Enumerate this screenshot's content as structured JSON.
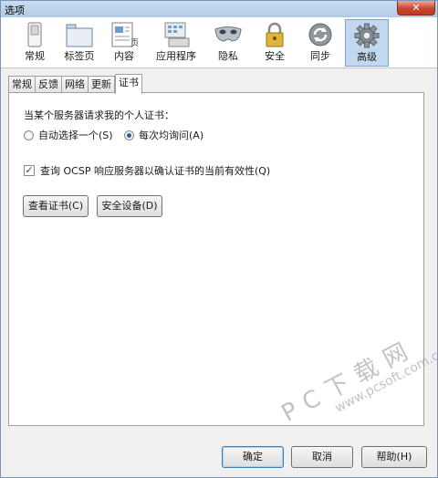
{
  "window": {
    "title": "选项",
    "close_glyph": "✕"
  },
  "toolbar": {
    "items": [
      {
        "label": "常规",
        "icon": "switch-icon"
      },
      {
        "label": "标签页",
        "icon": "tabs-icon"
      },
      {
        "label": "内容",
        "icon": "content-page-icon"
      },
      {
        "label": "应用程序",
        "icon": "applications-icon"
      },
      {
        "label": "隐私",
        "icon": "privacy-mask-icon"
      },
      {
        "label": "安全",
        "icon": "lock-icon"
      },
      {
        "label": "同步",
        "icon": "sync-icon"
      },
      {
        "label": "高级",
        "icon": "gear-icon"
      }
    ],
    "active": "高级"
  },
  "subtabs": {
    "items": [
      "常规",
      "反馈",
      "网络",
      "更新",
      "证书"
    ],
    "active": "证书"
  },
  "certificates": {
    "question": "当某个服务器请求我的个人证书：",
    "radio_auto": "自动选择一个(S)",
    "radio_ask": "每次均询问(A)",
    "radio_selected": "每次均询问(A)",
    "ocsp_label": "查询 OCSP 响应服务器以确认证书的当前有效性(Q)",
    "ocsp_checked": true,
    "view_certs_button": "查看证书(C)",
    "security_devices_button": "安全设备(D)"
  },
  "footer": {
    "ok_button": "确定",
    "cancel_button": "取消",
    "help_button": "帮助(H)"
  },
  "watermark": {
    "main": "PC下载网",
    "sub": "www.pcsoft.com.cn"
  }
}
